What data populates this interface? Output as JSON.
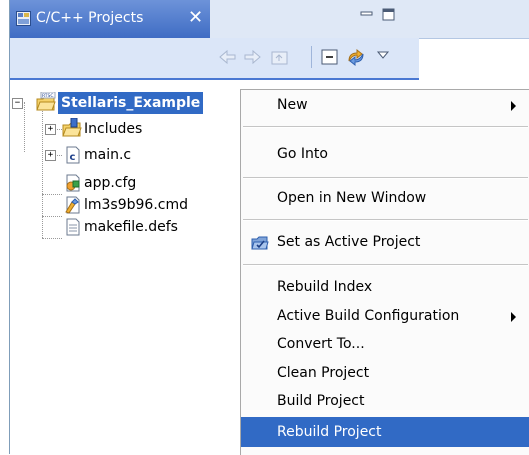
{
  "view": {
    "tab_title": "C/C++ Projects",
    "icons": {
      "tab": "projects-view-icon",
      "close": "close-icon",
      "minimize": "minimize-icon",
      "maximize": "maximize-icon",
      "back": "back-arrow-icon",
      "forward": "forward-arrow-icon",
      "up": "up-folder-icon",
      "collapse": "collapse-all-icon",
      "link": "link-with-editor-icon",
      "menu": "view-menu-icon"
    }
  },
  "tree": {
    "project": {
      "label": "Stellaris_Example",
      "badge": "RTSC",
      "expander": "−"
    },
    "items": [
      {
        "label": "Includes",
        "icon": "includes-folder-icon",
        "expander": "+"
      },
      {
        "label": "main.c",
        "icon": "c-source-file-icon",
        "expander": "+"
      },
      {
        "label": "app.cfg",
        "icon": "config-file-icon"
      },
      {
        "label": "lm3s9b96.cmd",
        "icon": "linker-cmd-file-icon"
      },
      {
        "label": "makefile.defs",
        "icon": "text-file-icon"
      }
    ]
  },
  "context_menu": {
    "items": [
      {
        "label": "New",
        "submenu": true
      },
      {
        "label": "Go Into"
      },
      {
        "label": "Open in New Window"
      },
      {
        "label": "Set as Active Project",
        "icon": "active-project-icon"
      },
      {
        "label": "Rebuild Index"
      },
      {
        "label": "Active Build Configuration",
        "submenu": true
      },
      {
        "label": "Convert To..."
      },
      {
        "label": "Clean Project"
      },
      {
        "label": "Build Project"
      },
      {
        "label": "Rebuild Project",
        "selected": true
      }
    ]
  },
  "colors": {
    "selection": "#316ac5",
    "tab_active": "#3f6cc4",
    "toolbar": "#dbe6f8"
  }
}
